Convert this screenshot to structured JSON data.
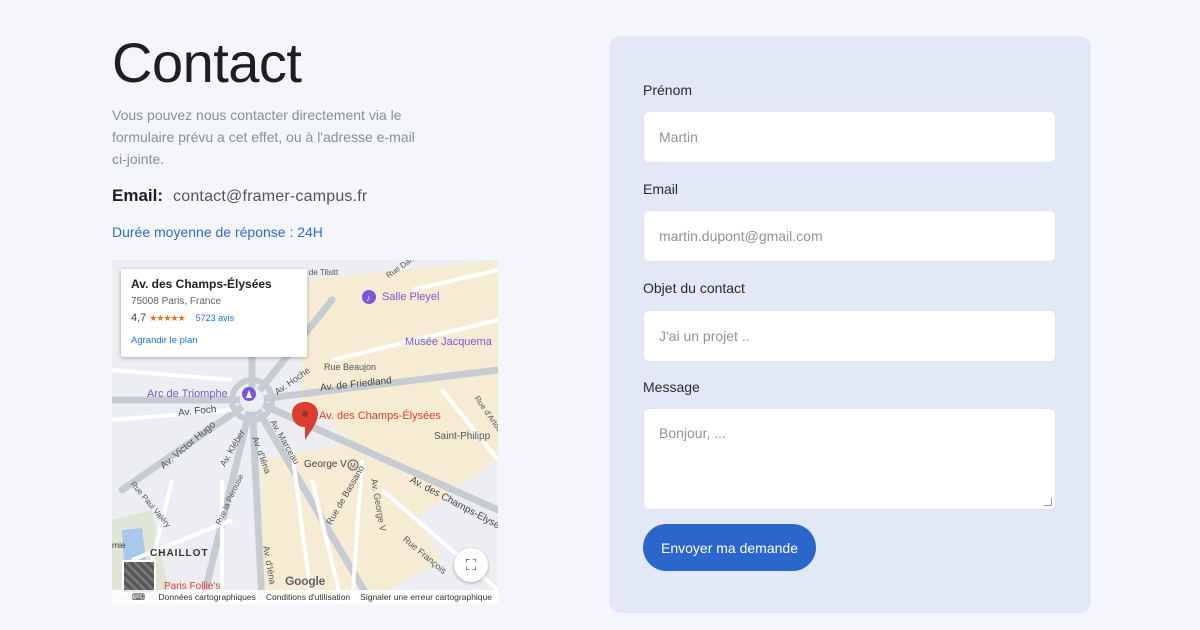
{
  "contact": {
    "title": "Contact",
    "intro": "Vous pouvez nous contacter directement via le formulaire prévu a cet effet, ou à l'adresse e-mail ci-jointe.",
    "email_label": "Email:",
    "email_value": "contact@framer-campus.fr",
    "response_time": "Durée moyenne de réponse : 24H"
  },
  "map": {
    "card": {
      "title": "Av. des Champs-Élysées",
      "address": "75008 Paris, France",
      "rating": "4,7",
      "stars": "★★★★★",
      "reviews": "5723 avis",
      "enlarge": "Agrandir le plan"
    },
    "labels": {
      "salle_pleyel": "Salle Pleyel",
      "musee": "Musée Jacquema",
      "rue_beaujon": "Rue Beaujon",
      "av_friedland": "Av. de Friedland",
      "arc": "Arc de Triomphe",
      "av_foch": "Av. Foch",
      "av_hoche": "Av. Hoche",
      "marker": "Av. des Champs-Élysées",
      "saint_philippe": "Saint-Philipp",
      "av_victor_hugo": "Av. Victor Hugo",
      "av_kleber": "Av. Kléber",
      "av_iena": "Av. d'Iéna",
      "av_marceau": "Av. Marceau",
      "george_v": "George V",
      "rue_bassano": "Rue de Bassano",
      "av_george_v": "Av. George V",
      "av_champs": "Av. des Champs-Elysées",
      "rue_francois": "Rue François",
      "rue_artois": "Rue d'Artois",
      "rue_daru": "Rue Daru",
      "rue_paul_valery": "Rue Paul Valéry",
      "rue_perouse": "Rue la Pérouse",
      "chaillot": "CHAILLOT",
      "paris_follie": "Paris Follie's",
      "av_iena_2": "Av. d'Iéna",
      "rue_tilsitt": "Rue de Tilsitt",
      "ernie": "rnie"
    },
    "google": "Google",
    "footer": {
      "data": "Données cartographiques",
      "terms": "Conditions d'utilisation",
      "report": "Signaler une erreur cartographique"
    },
    "colors": {
      "marker": "#d93f30",
      "poi": "#7b56d6",
      "road": "#c7ccd3"
    }
  },
  "form": {
    "firstname_label": "Prénom",
    "firstname_placeholder": "Martin",
    "email_label": "Email",
    "email_placeholder": "martin.dupont@gmail.com",
    "subject_label": "Objet du contact",
    "subject_placeholder": "J'ai un projet ..",
    "message_label": "Message",
    "message_placeholder": "Bonjour, ...",
    "submit_label": "Envoyer ma demande",
    "accent": "#2a66cc"
  }
}
